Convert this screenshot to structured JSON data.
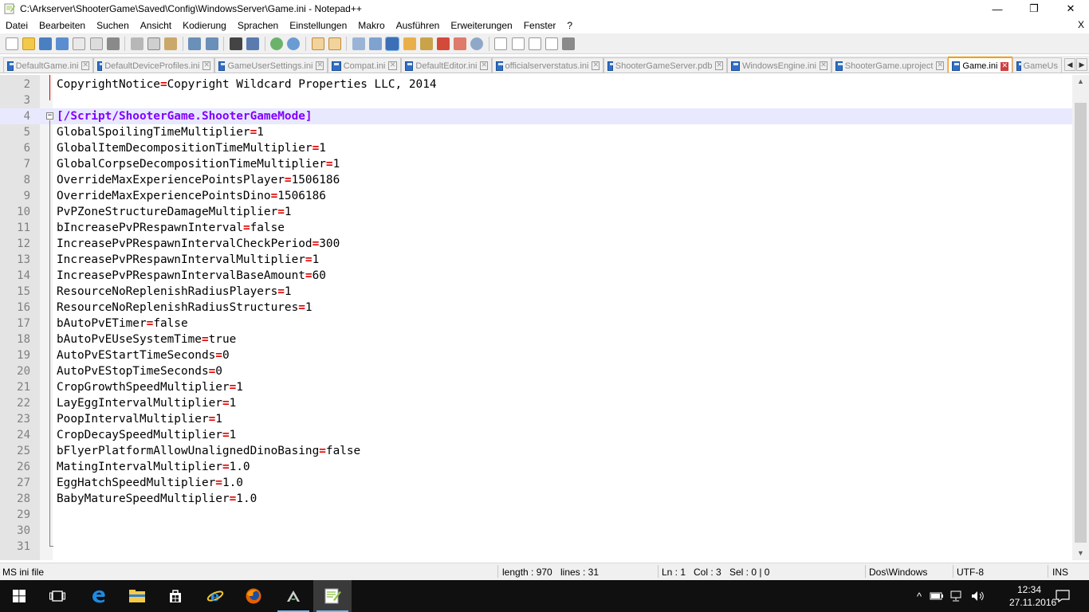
{
  "window": {
    "title": "C:\\Arkserver\\ShooterGame\\Saved\\Config\\WindowsServer\\Game.ini - Notepad++",
    "minimize": "—",
    "maximize": "❐",
    "close": "✕"
  },
  "menu": {
    "items": [
      "Datei",
      "Bearbeiten",
      "Suchen",
      "Ansicht",
      "Kodierung",
      "Sprachen",
      "Einstellungen",
      "Makro",
      "Ausführen",
      "Erweiterungen",
      "Fenster",
      "?"
    ],
    "close_doc": "X"
  },
  "tabs": [
    {
      "label": "DefaultGame.ini"
    },
    {
      "label": "DefaultDeviceProfiles.ini"
    },
    {
      "label": "GameUserSettings.ini"
    },
    {
      "label": "Compat.ini"
    },
    {
      "label": "DefaultEditor.ini"
    },
    {
      "label": "officialserverstatus.ini"
    },
    {
      "label": "ShooterGameServer.pdb"
    },
    {
      "label": "WindowsEngine.ini"
    },
    {
      "label": "ShooterGame.uproject"
    },
    {
      "label": "Game.ini"
    },
    {
      "label": "GameUs"
    }
  ],
  "editor": {
    "lines": [
      {
        "num": "2",
        "key": "CopyrightNotice",
        "op": "=",
        "val": "Copyright Wildcard Properties LLC, 2014"
      },
      {
        "num": "3",
        "key": "",
        "op": "",
        "val": ""
      },
      {
        "num": "4",
        "section": "[/Script/ShooterGame.ShooterGameMode]"
      },
      {
        "num": "5",
        "key": "GlobalSpoilingTimeMultiplier",
        "op": "=",
        "val": "1"
      },
      {
        "num": "6",
        "key": "GlobalItemDecompositionTimeMultiplier",
        "op": "=",
        "val": "1"
      },
      {
        "num": "7",
        "key": "GlobalCorpseDecompositionTimeMultiplier",
        "op": "=",
        "val": "1"
      },
      {
        "num": "8",
        "key": "OverrideMaxExperiencePointsPlayer",
        "op": "=",
        "val": "1506186"
      },
      {
        "num": "9",
        "key": "OverrideMaxExperiencePointsDino",
        "op": "=",
        "val": "1506186"
      },
      {
        "num": "10",
        "key": "PvPZoneStructureDamageMultiplier",
        "op": "=",
        "val": "1"
      },
      {
        "num": "11",
        "key": "bIncreasePvPRespawnInterval",
        "op": "=",
        "val": "false"
      },
      {
        "num": "12",
        "key": "IncreasePvPRespawnIntervalCheckPeriod",
        "op": "=",
        "val": "300"
      },
      {
        "num": "13",
        "key": "IncreasePvPRespawnIntervalMultiplier",
        "op": "=",
        "val": "1"
      },
      {
        "num": "14",
        "key": "IncreasePvPRespawnIntervalBaseAmount",
        "op": "=",
        "val": "60"
      },
      {
        "num": "15",
        "key": "ResourceNoReplenishRadiusPlayers",
        "op": "=",
        "val": "1"
      },
      {
        "num": "16",
        "key": "ResourceNoReplenishRadiusStructures",
        "op": "=",
        "val": "1"
      },
      {
        "num": "17",
        "key": "bAutoPvETimer",
        "op": "=",
        "val": "false"
      },
      {
        "num": "18",
        "key": "bAutoPvEUseSystemTime",
        "op": "=",
        "val": "true"
      },
      {
        "num": "19",
        "key": "AutoPvEStartTimeSeconds",
        "op": "=",
        "val": "0"
      },
      {
        "num": "20",
        "key": "AutoPvEStopTimeSeconds",
        "op": "=",
        "val": "0"
      },
      {
        "num": "21",
        "key": "CropGrowthSpeedMultiplier",
        "op": "=",
        "val": "1"
      },
      {
        "num": "22",
        "key": "LayEggIntervalMultiplier",
        "op": "=",
        "val": "1"
      },
      {
        "num": "23",
        "key": "PoopIntervalMultiplier",
        "op": "=",
        "val": "1"
      },
      {
        "num": "24",
        "key": "CropDecaySpeedMultiplier",
        "op": "=",
        "val": "1"
      },
      {
        "num": "25",
        "key": "bFlyerPlatformAllowUnalignedDinoBasing",
        "op": "=",
        "val": "false"
      },
      {
        "num": "26",
        "key": "MatingIntervalMultiplier",
        "op": "=",
        "val": "1.0"
      },
      {
        "num": "27",
        "key": "EggHatchSpeedMultiplier",
        "op": "=",
        "val": "1.0"
      },
      {
        "num": "28",
        "key": "BabyMatureSpeedMultiplier",
        "op": "=",
        "val": "1.0"
      },
      {
        "num": "29",
        "key": "",
        "op": "",
        "val": ""
      },
      {
        "num": "30",
        "key": "",
        "op": "",
        "val": ""
      },
      {
        "num": "31",
        "key": "",
        "op": "",
        "val": ""
      }
    ]
  },
  "status": {
    "filetype": "MS ini file",
    "length": "length : 970",
    "lines": "lines : 31",
    "ln": "Ln : 1",
    "col": "Col : 3",
    "sel": "Sel : 0 | 0",
    "eol": "Dos\\Windows",
    "encoding": "UTF-8",
    "mode": "INS"
  },
  "taskbar": {
    "time": "12:34",
    "date": "27.11.2016",
    "tray_chevron": "^"
  },
  "colors": {
    "accent_tab": "#f5a000",
    "operator": "#e00000",
    "section": "#8000ff",
    "current_line": "#e8e8ff"
  }
}
